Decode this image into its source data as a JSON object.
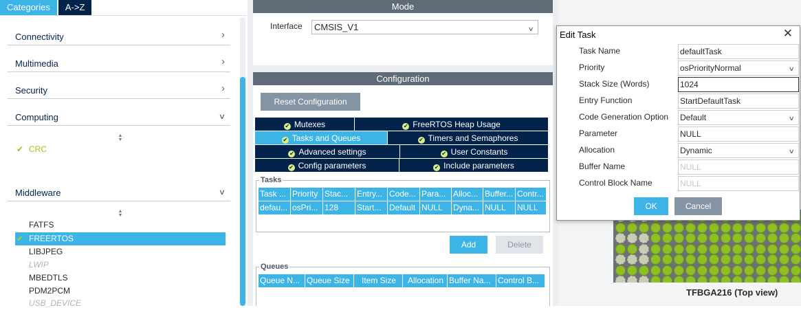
{
  "left": {
    "tabs": [
      "Categories",
      "A->Z"
    ],
    "categories": [
      "Connectivity",
      "Multimedia",
      "Security",
      "Computing",
      "Middleware"
    ],
    "computing_items": [
      "CRC"
    ],
    "middleware_items": [
      {
        "label": "FATFS",
        "state": "normal"
      },
      {
        "label": "FREERTOS",
        "state": "selected"
      },
      {
        "label": "LIBJPEG",
        "state": "normal"
      },
      {
        "label": "LWIP",
        "state": "disabled"
      },
      {
        "label": "MBEDTLS",
        "state": "normal"
      },
      {
        "label": "PDM2PCM",
        "state": "normal"
      },
      {
        "label": "USB_DEVICE",
        "state": "disabled"
      }
    ]
  },
  "mode": {
    "title": "Mode",
    "interface_label": "Interface",
    "interface_value": "CMSIS_V1"
  },
  "config": {
    "title": "Configuration",
    "reset_label": "Reset Configuration",
    "tabs_row1": [
      "Mutexes",
      "FreeRTOS Heap Usage"
    ],
    "tabs_row2": [
      "Tasks and Queues",
      "Timers and Semaphores"
    ],
    "tabs_row3": [
      "Advanced settings",
      "User Constants"
    ],
    "tabs_row4": [
      "Config parameters",
      "Include parameters"
    ],
    "active_tab": "Tasks and Queues",
    "tasks_legend": "Tasks",
    "tasks_columns": [
      "Task ...",
      "Priority",
      "Stac...",
      "Entry...",
      "Code...",
      "Para...",
      "Alloc...",
      "Buffer...",
      "Contr..."
    ],
    "tasks_rows": [
      [
        "defau...",
        "osPri...",
        "128",
        "Start...",
        "Default",
        "NULL",
        "Dyna...",
        "NULL",
        "NULL"
      ]
    ],
    "add_label": "Add",
    "delete_label": "Delete",
    "queues_legend": "Queues",
    "queues_columns": [
      "Queue N...",
      "Queue Size",
      "Item Size",
      "Allocation",
      "Buffer Na...",
      "Control B..."
    ]
  },
  "board": {
    "caption": "TFBGA216 (Top view)"
  },
  "dialog": {
    "title": "Edit Task",
    "fields": [
      {
        "label": "Task Name",
        "value": "defaultTask",
        "kind": "text"
      },
      {
        "label": "Priority",
        "value": "osPriorityNormal",
        "kind": "select"
      },
      {
        "label": "Stack Size (Words)",
        "value": "1024",
        "kind": "text-focused"
      },
      {
        "label": "Entry Function",
        "value": "StartDefaultTask",
        "kind": "text"
      },
      {
        "label": "Code Generation Option",
        "value": "Default",
        "kind": "select"
      },
      {
        "label": "Parameter",
        "value": "NULL",
        "kind": "text"
      },
      {
        "label": "Allocation",
        "value": "Dynamic",
        "kind": "select"
      },
      {
        "label": "Buffer Name",
        "value": "NULL",
        "kind": "placeholder"
      },
      {
        "label": "Control Block Name",
        "value": "NULL",
        "kind": "placeholder"
      }
    ],
    "ok_label": "OK",
    "cancel_label": "Cancel"
  },
  "colors": {
    "accent": "#3cb4e6",
    "navy": "#03234b",
    "section_header": "#5f6b77",
    "check_green": "#a4c21f",
    "pin_green": "#8fbf24"
  },
  "icons": [
    "chevron-right-icon",
    "chevron-down-icon",
    "sort-icon",
    "check-icon",
    "ok-check-icon",
    "close-icon",
    "dropdown-arrow-icon"
  ]
}
